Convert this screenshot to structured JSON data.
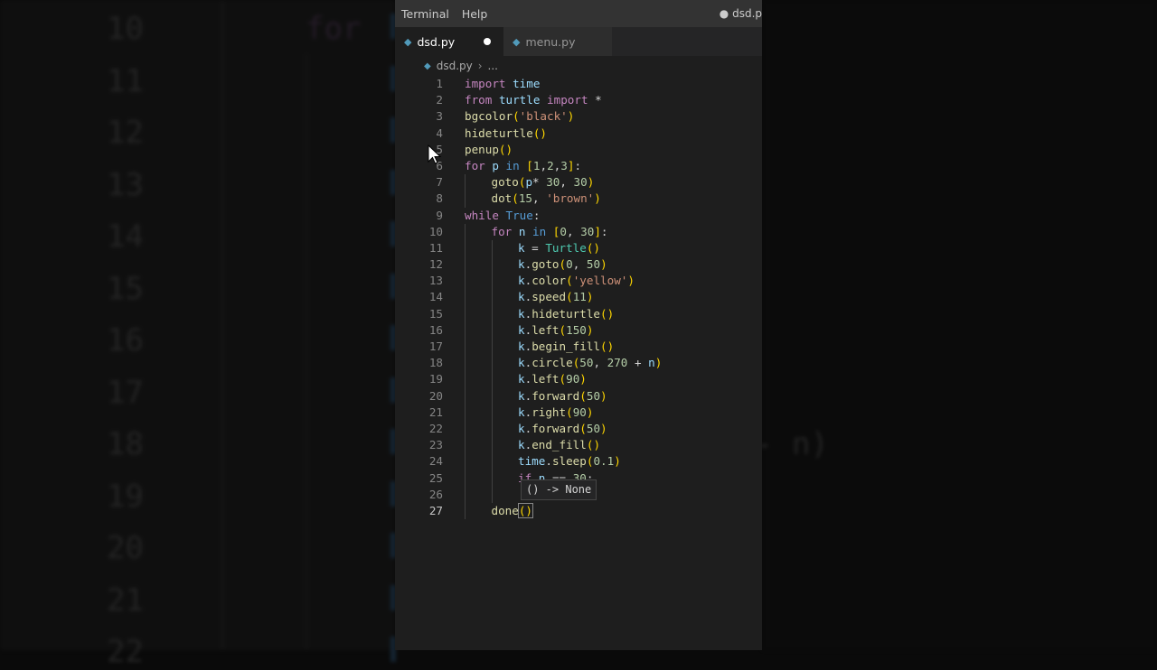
{
  "menubar": {
    "items": [
      "Terminal",
      "Help"
    ],
    "title_right": "● dsd.p"
  },
  "tabs": [
    {
      "label": "dsd.py",
      "active": true,
      "dirty": true
    },
    {
      "label": "menu.py",
      "active": false,
      "dirty": false
    }
  ],
  "breadcrumb": {
    "file": "dsd.py",
    "rest": "..."
  },
  "hover_text": "() -> None",
  "background": {
    "line_numbers": [
      "10",
      "11",
      "12",
      "13",
      "14",
      "15",
      "16",
      "17",
      "18",
      "19",
      "20",
      "21",
      "22"
    ],
    "left_text": "for",
    "right_text": "- n)"
  },
  "colors": {
    "editor_bg": "#1e1e1e",
    "keyword": "#c586c0",
    "function": "#dcdcaa",
    "string": "#ce9178",
    "number": "#b5cea8",
    "class": "#4ec9b0",
    "bracket": "#ffd700"
  },
  "code": {
    "lines": [
      {
        "n": "1",
        "indent": 0,
        "t": [
          [
            "kw",
            "import"
          ],
          [
            "op",
            " "
          ],
          [
            "var",
            "time"
          ]
        ]
      },
      {
        "n": "2",
        "indent": 0,
        "t": [
          [
            "kw",
            "from"
          ],
          [
            "op",
            " "
          ],
          [
            "var",
            "turtle"
          ],
          [
            "op",
            " "
          ],
          [
            "kw",
            "import"
          ],
          [
            "op",
            " *"
          ]
        ]
      },
      {
        "n": "3",
        "indent": 0,
        "t": [
          [
            "fn",
            "bgcolor"
          ],
          [
            "par",
            "("
          ],
          [
            "str",
            "'black'"
          ],
          [
            "par",
            ")"
          ]
        ]
      },
      {
        "n": "4",
        "indent": 0,
        "t": [
          [
            "fn",
            "hideturtle"
          ],
          [
            "par",
            "()"
          ]
        ]
      },
      {
        "n": "5",
        "indent": 0,
        "t": [
          [
            "fn",
            "penup"
          ],
          [
            "par",
            "()"
          ]
        ]
      },
      {
        "n": "6",
        "indent": 0,
        "t": [
          [
            "kw",
            "for"
          ],
          [
            "op",
            " "
          ],
          [
            "var",
            "p"
          ],
          [
            "op",
            " "
          ],
          [
            "bl",
            "in"
          ],
          [
            "op",
            " "
          ],
          [
            "par",
            "["
          ],
          [
            "num",
            "1"
          ],
          [
            "op",
            ","
          ],
          [
            "num",
            "2"
          ],
          [
            "op",
            ","
          ],
          [
            "num",
            "3"
          ],
          [
            "par",
            "]"
          ],
          [
            "op",
            ":"
          ]
        ]
      },
      {
        "n": "7",
        "indent": 1,
        "t": [
          [
            "fn",
            "goto"
          ],
          [
            "par",
            "("
          ],
          [
            "var",
            "p"
          ],
          [
            "op",
            "* "
          ],
          [
            "num",
            "30"
          ],
          [
            "op",
            ", "
          ],
          [
            "num",
            "30"
          ],
          [
            "par",
            ")"
          ]
        ]
      },
      {
        "n": "8",
        "indent": 1,
        "t": [
          [
            "fn",
            "dot"
          ],
          [
            "par",
            "("
          ],
          [
            "num",
            "15"
          ],
          [
            "op",
            ", "
          ],
          [
            "str",
            "'brown'"
          ],
          [
            "par",
            ")"
          ]
        ]
      },
      {
        "n": "9",
        "indent": 0,
        "t": [
          [
            "kw",
            "while"
          ],
          [
            "op",
            " "
          ],
          [
            "bl",
            "True"
          ],
          [
            "op",
            ":"
          ]
        ]
      },
      {
        "n": "10",
        "indent": 1,
        "t": [
          [
            "kw",
            "for"
          ],
          [
            "op",
            " "
          ],
          [
            "var",
            "n"
          ],
          [
            "op",
            " "
          ],
          [
            "bl",
            "in"
          ],
          [
            "op",
            " "
          ],
          [
            "par",
            "["
          ],
          [
            "num",
            "0"
          ],
          [
            "op",
            ", "
          ],
          [
            "num",
            "30"
          ],
          [
            "par",
            "]"
          ],
          [
            "op",
            ":"
          ]
        ]
      },
      {
        "n": "11",
        "indent": 2,
        "t": [
          [
            "var",
            "k"
          ],
          [
            "op",
            " = "
          ],
          [
            "cls",
            "Turtle"
          ],
          [
            "par",
            "()"
          ]
        ]
      },
      {
        "n": "12",
        "indent": 2,
        "t": [
          [
            "var",
            "k"
          ],
          [
            "op",
            "."
          ],
          [
            "fn",
            "goto"
          ],
          [
            "par",
            "("
          ],
          [
            "num",
            "0"
          ],
          [
            "op",
            ", "
          ],
          [
            "num",
            "50"
          ],
          [
            "par",
            ")"
          ]
        ]
      },
      {
        "n": "13",
        "indent": 2,
        "t": [
          [
            "var",
            "k"
          ],
          [
            "op",
            "."
          ],
          [
            "fn",
            "color"
          ],
          [
            "par",
            "("
          ],
          [
            "str",
            "'yellow'"
          ],
          [
            "par",
            ")"
          ]
        ]
      },
      {
        "n": "14",
        "indent": 2,
        "t": [
          [
            "var",
            "k"
          ],
          [
            "op",
            "."
          ],
          [
            "fn",
            "speed"
          ],
          [
            "par",
            "("
          ],
          [
            "num",
            "11"
          ],
          [
            "par",
            ")"
          ]
        ]
      },
      {
        "n": "15",
        "indent": 2,
        "t": [
          [
            "var",
            "k"
          ],
          [
            "op",
            "."
          ],
          [
            "fn",
            "hideturtle"
          ],
          [
            "par",
            "()"
          ]
        ]
      },
      {
        "n": "16",
        "indent": 2,
        "t": [
          [
            "var",
            "k"
          ],
          [
            "op",
            "."
          ],
          [
            "fn",
            "left"
          ],
          [
            "par",
            "("
          ],
          [
            "num",
            "150"
          ],
          [
            "par",
            ")"
          ]
        ]
      },
      {
        "n": "17",
        "indent": 2,
        "t": [
          [
            "var",
            "k"
          ],
          [
            "op",
            "."
          ],
          [
            "fn",
            "begin_fill"
          ],
          [
            "par",
            "()"
          ]
        ]
      },
      {
        "n": "18",
        "indent": 2,
        "t": [
          [
            "var",
            "k"
          ],
          [
            "op",
            "."
          ],
          [
            "fn",
            "circle"
          ],
          [
            "par",
            "("
          ],
          [
            "num",
            "50"
          ],
          [
            "op",
            ", "
          ],
          [
            "num",
            "270"
          ],
          [
            "op",
            " + "
          ],
          [
            "var",
            "n"
          ],
          [
            "par",
            ")"
          ]
        ]
      },
      {
        "n": "19",
        "indent": 2,
        "t": [
          [
            "var",
            "k"
          ],
          [
            "op",
            "."
          ],
          [
            "fn",
            "left"
          ],
          [
            "par",
            "("
          ],
          [
            "num",
            "90"
          ],
          [
            "par",
            ")"
          ]
        ]
      },
      {
        "n": "20",
        "indent": 2,
        "t": [
          [
            "var",
            "k"
          ],
          [
            "op",
            "."
          ],
          [
            "fn",
            "forward"
          ],
          [
            "par",
            "("
          ],
          [
            "num",
            "50"
          ],
          [
            "par",
            ")"
          ]
        ]
      },
      {
        "n": "21",
        "indent": 2,
        "t": [
          [
            "var",
            "k"
          ],
          [
            "op",
            "."
          ],
          [
            "fn",
            "right"
          ],
          [
            "par",
            "("
          ],
          [
            "num",
            "90"
          ],
          [
            "par",
            ")"
          ]
        ]
      },
      {
        "n": "22",
        "indent": 2,
        "t": [
          [
            "var",
            "k"
          ],
          [
            "op",
            "."
          ],
          [
            "fn",
            "forward"
          ],
          [
            "par",
            "("
          ],
          [
            "num",
            "50"
          ],
          [
            "par",
            ")"
          ]
        ]
      },
      {
        "n": "23",
        "indent": 2,
        "t": [
          [
            "var",
            "k"
          ],
          [
            "op",
            "."
          ],
          [
            "fn",
            "end_fill"
          ],
          [
            "par",
            "()"
          ]
        ]
      },
      {
        "n": "24",
        "indent": 2,
        "t": [
          [
            "var",
            "time"
          ],
          [
            "op",
            "."
          ],
          [
            "fn",
            "sleep"
          ],
          [
            "par",
            "("
          ],
          [
            "num",
            "0.1"
          ],
          [
            "par",
            ")"
          ]
        ]
      },
      {
        "n": "25",
        "indent": 2,
        "t": [
          [
            "kw",
            "if"
          ],
          [
            "op",
            " "
          ],
          [
            "var",
            "n"
          ],
          [
            "op",
            " == "
          ],
          [
            "num",
            "30"
          ],
          [
            "op",
            ":"
          ]
        ]
      },
      {
        "n": "26",
        "indent": 2,
        "t": [
          [
            "op",
            "         "
          ],
          [
            "par",
            ")"
          ]
        ]
      },
      {
        "n": "27",
        "indent": 1,
        "current": true,
        "t": [
          [
            "fn",
            "done"
          ],
          [
            "par",
            "()"
          ]
        ]
      }
    ]
  }
}
